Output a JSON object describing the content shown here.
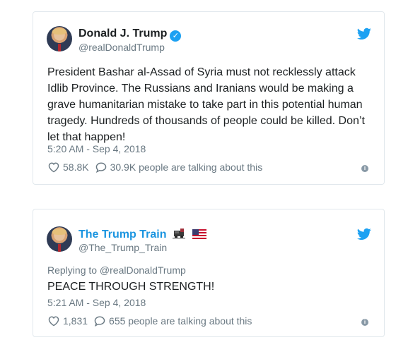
{
  "tweets": [
    {
      "name": "Donald J. Trump",
      "handle": "@realDonaldTrump",
      "verified": true,
      "text": "President Bashar al-Assad of Syria must not recklessly attack\nIdlib Province. The Russians and Iranians would be making a\ngrave humanitarian mistake to take part in this potential human\ntragedy. Hundreds of thousands of people could be killed. Don’t\nlet that happen!",
      "time": "5:20 AM - Sep 4, 2018",
      "likes": "58.8K",
      "talking": "30.9K people are talking about this"
    },
    {
      "name": "The Trump Train",
      "handle": "@The_Trump_Train",
      "replying_to": "Replying to @realDonaldTrump",
      "text": "PEACE THROUGH STRENGTH!",
      "time": "5:21 AM - Sep 4, 2018",
      "likes": "1,831",
      "talking": "655 people are talking about this"
    }
  ],
  "colors": {
    "twitter_blue": "#1da1f2",
    "name_link_blue": "#1b95e0",
    "muted": "#697882"
  },
  "icons": {
    "brand": "twitter-bird-icon",
    "like": "heart-icon",
    "reply": "speech-bubble-icon",
    "info": "info-icon",
    "verified": "verified-badge-icon"
  }
}
